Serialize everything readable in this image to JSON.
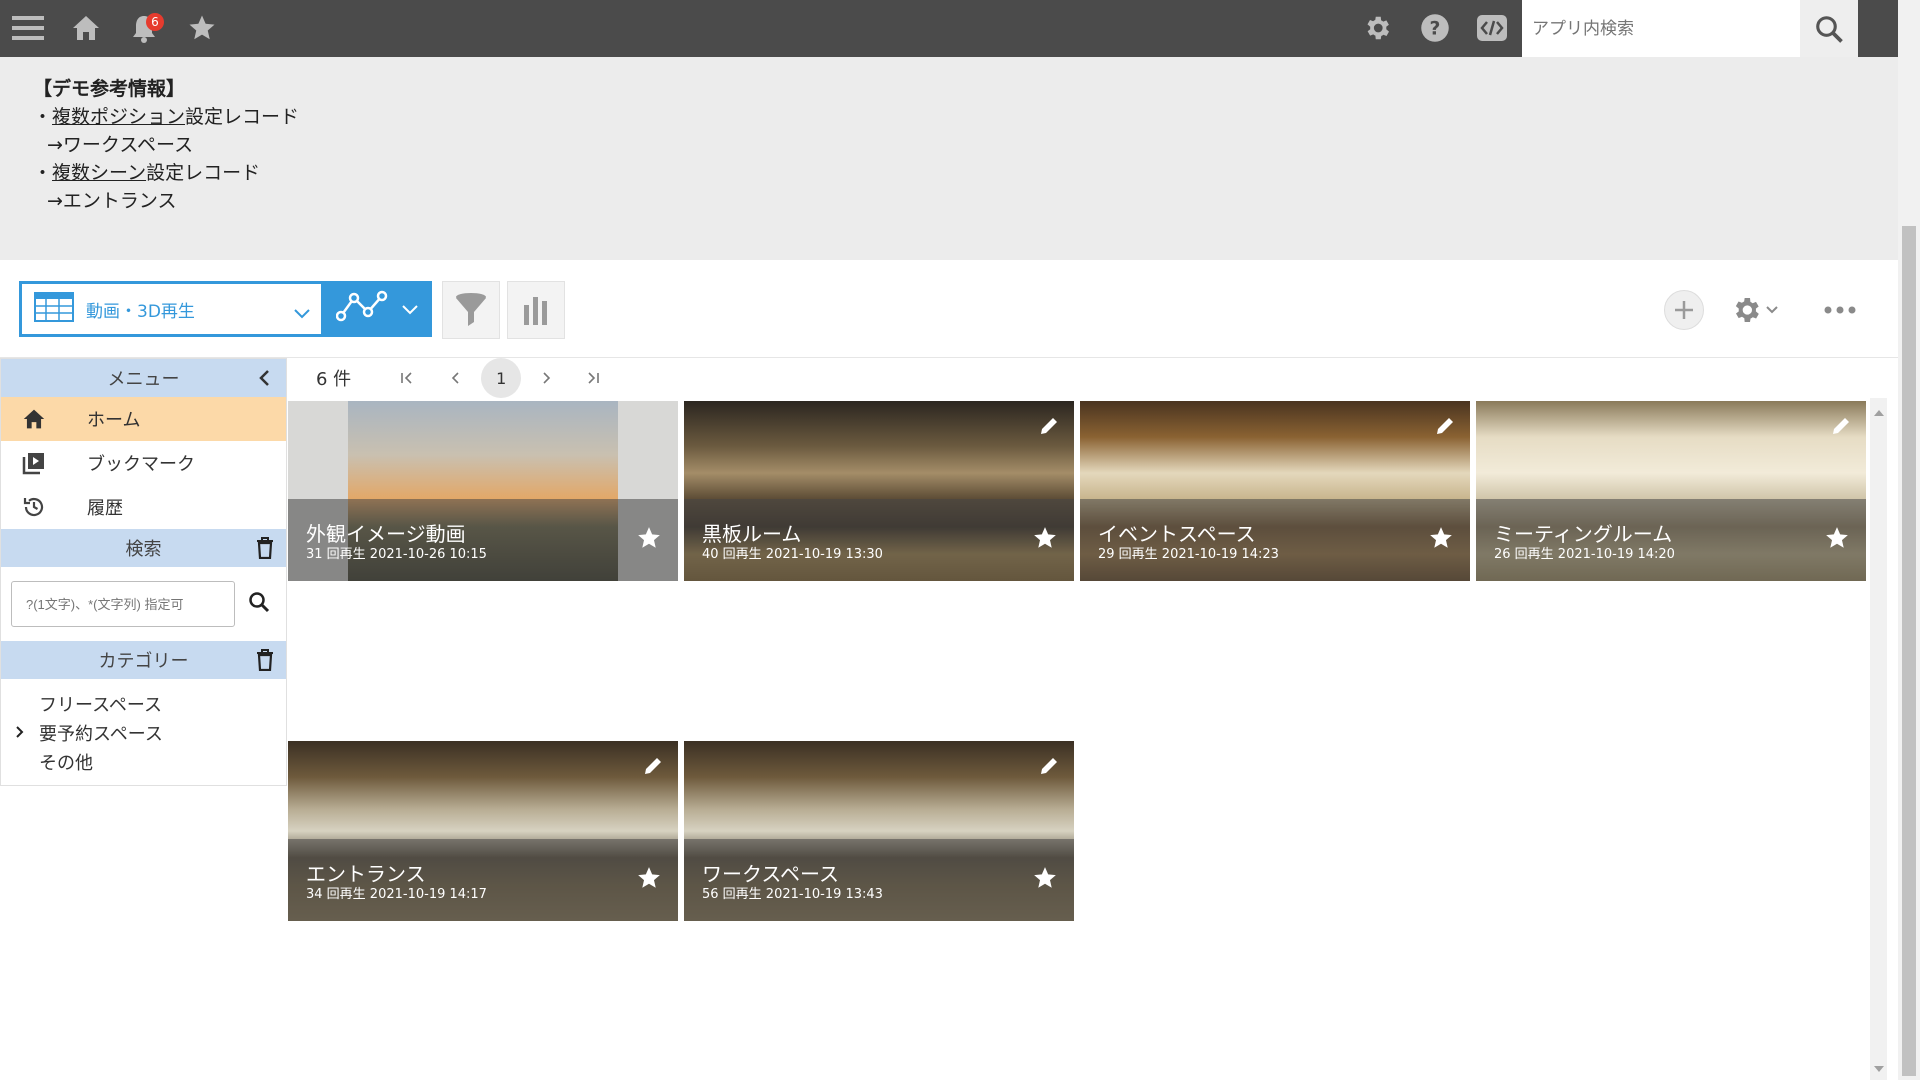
{
  "topbar": {
    "notification_count": "6",
    "search_placeholder": "アプリ内検索"
  },
  "info": {
    "title": "【デモ参考情報】",
    "lines": [
      {
        "bullet": "・",
        "link": "複数ポジション",
        "rest": "設定レコード",
        "sub": "→ワークスペース"
      },
      {
        "bullet": "・",
        "link": "複数シーン",
        "rest": "設定レコード",
        "sub": "→エントランス"
      }
    ]
  },
  "toolbar": {
    "view_label": "動画・3D再生"
  },
  "sidebar": {
    "menu_title": "メニュー",
    "items": [
      {
        "label": "ホーム",
        "icon": "home-icon"
      },
      {
        "label": "ブックマーク",
        "icon": "bookmark-play-icon"
      },
      {
        "label": "履歴",
        "icon": "history-icon"
      }
    ],
    "search_title": "検索",
    "search_placeholder": "?(1文字)、*(文字列) 指定可",
    "category_title": "カテゴリー",
    "categories": [
      "フリースペース",
      "要予約スペース",
      "その他"
    ]
  },
  "pager": {
    "count": "6 件",
    "current_page": "1"
  },
  "cards": [
    {
      "title": "外観イメージ動画",
      "meta": "31 回再生 2021-10-26 10:15"
    },
    {
      "title": "黒板ルーム",
      "meta": "40 回再生 2021-10-19 13:30"
    },
    {
      "title": "イベントスペース",
      "meta": "29 回再生 2021-10-19 14:23"
    },
    {
      "title": "ミーティングルーム",
      "meta": "26 回再生 2021-10-19 14:20"
    },
    {
      "title": "エントランス",
      "meta": "34 回再生 2021-10-19 14:17"
    },
    {
      "title": "ワークスペース",
      "meta": "56 回再生 2021-10-19 13:43"
    }
  ]
}
